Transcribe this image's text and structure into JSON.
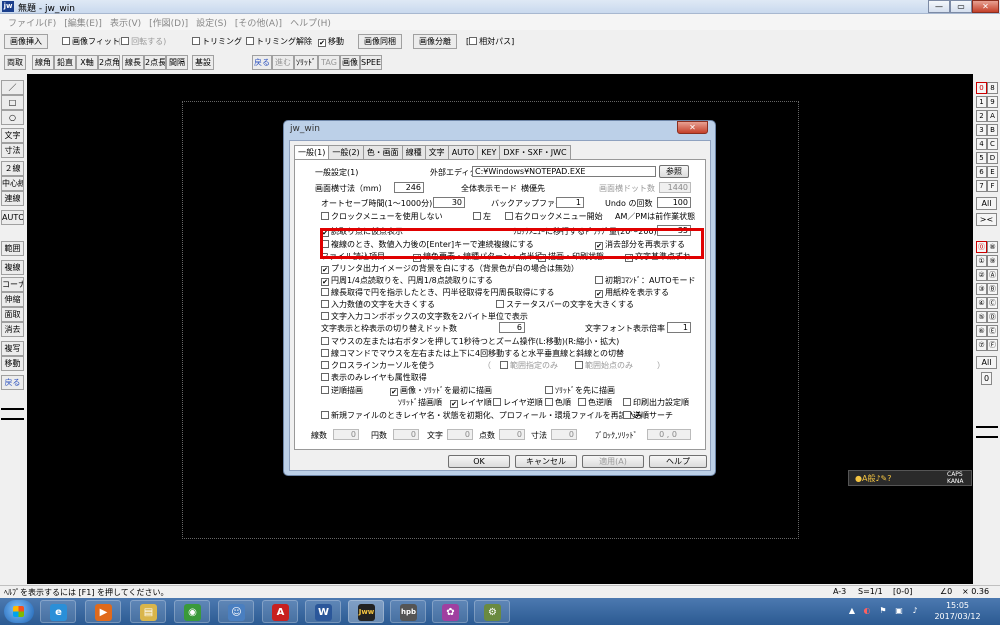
{
  "window": {
    "title": "無題 - jw_win",
    "logo": "jw",
    "minimize": "—",
    "maximize": "▭",
    "close": "✕"
  },
  "menu": [
    "ファイル(F)",
    "[編集(E)]",
    "表示(V)",
    "[作図(D)]",
    "設定(S)",
    "[その他(A)]",
    "ヘルプ(H)"
  ],
  "toolbar1": {
    "insert_image": "画像挿入",
    "fit_image": "画像フィット",
    "rotate_open": "(",
    "rotate": "回転する",
    "rotate_close": ")",
    "trimming": "トリミング",
    "trimming_cancel": "トリミング解除",
    "move": "移動",
    "image_same": "画像同梱",
    "image_split": "画像分離",
    "relpath_open": "[",
    "relpath": "相対パス",
    "relpath_close": "]"
  },
  "toolbar2": [
    "両取",
    "線角",
    "鉛直",
    "X軸",
    "2点角",
    "線長",
    "2点長",
    "間隔",
    "基設",
    "戻る",
    "進む",
    "ｿﾘｯﾄﾞ",
    "TAG",
    "画像",
    "SPEED"
  ],
  "left_tools": [
    "／",
    "□",
    "○",
    "文字",
    "寸法",
    "２線",
    "中心線",
    "連線",
    "AUTO",
    "範囲",
    "複線",
    "コーナー",
    "伸縮",
    "面取",
    "消去",
    "複写",
    "移動",
    "戻る"
  ],
  "right_pairs_top": [
    [
      "0",
      "8"
    ],
    [
      "1",
      "9"
    ],
    [
      "2",
      "A"
    ],
    [
      "3",
      "B"
    ],
    [
      "4",
      "C"
    ],
    [
      "5",
      "D"
    ],
    [
      "6",
      "E"
    ],
    [
      "7",
      "F"
    ]
  ],
  "right_pairs_bottom": [
    [
      "⓪",
      "⑧"
    ],
    [
      "①",
      "⑨"
    ],
    [
      "②",
      "Ⓐ"
    ],
    [
      "③",
      "Ⓑ"
    ],
    [
      "④",
      "Ⓒ"
    ],
    [
      "⑤",
      "Ⓓ"
    ],
    [
      "⑥",
      "Ⓔ"
    ],
    [
      "⑦",
      "Ⓕ"
    ]
  ],
  "right_all": "All",
  "right_arrow": "><",
  "right_zero": "0",
  "dialog": {
    "title": "jw_win",
    "close": "✕",
    "tabs": [
      "一般(1)",
      "一般(2)",
      "色・画面",
      "線種",
      "文字",
      "AUTO",
      "KEY",
      "DXF・SXF・JWC"
    ],
    "header": "一般設定(1)",
    "editor_label": "外部エディタ",
    "editor_value": "C:¥Windows¥NOTEPAD.EXE",
    "browse": "参照",
    "screen_size_label": "画面横寸法（mm）",
    "screen_size_value": "246",
    "full_mode": "全体表示モード",
    "priority": "横優先",
    "dots_label": "画面横ドット数",
    "dots_value": "1440",
    "autosave_label": "オートセーブ時間(1～1000分)",
    "autosave_value": "30",
    "backup_label": "バックアップファイル数",
    "backup_value": "1",
    "undo_label": "Undo の回数",
    "undo_value": "100",
    "clock_menu": "クロックメニューを使用しない",
    "left": "左",
    "right_start": "右クロックメニュー開始",
    "ampm": "AM／PMは前作業状態",
    "read_point": "読取り点に仮点表示",
    "clock_drag_label": "ｸﾛｯｸﾒﾆｭｰに移行するﾄﾞﾗｯｸﾞ量(20～200)",
    "clock_drag_value": "35",
    "multi_line": "複線のとき、数値入力後の[Enter]キーで連続複線にする",
    "redraw_erased": "消去部分を再表示する",
    "file_items_label": "ファイル読込項目",
    "line_color": "線色要素・線種パターン・点半径",
    "draw_print": "描画・印刷状態",
    "text_base": "文字基準点ずれ",
    "print_white": "プリンタ出力イメージの背景を白にする（背景色が白の場合は無効）",
    "circle_read": "円周1/4点読取りを、円周1/8点読取りにする",
    "init_auto": "初期ｺﾏﾝﾄﾞ：AUTOモード",
    "circle_radius": "線長取得で円を指示したとき、円半径取得を円周長取得にする",
    "paper_frame": "用紙枠を表示する",
    "input_large": "入力数値の文字を大きくする",
    "status_large": "ステータスバーの文字を大きくする",
    "combo_2byte": "文字入力コンボボックスの文字数を2バイト単位で表示",
    "switch_dots_label": "文字表示と枠表示の切り替えドット数",
    "switch_dots_value": "6",
    "font_scale_label": "文字フォント表示倍率",
    "font_scale_value": "1",
    "mouse_zoom": "マウスの左または右ボタンを押して1秒待つとズーム操作(L:移動)(R:縮小・拡大)",
    "line_command": "線コマンドでマウスを左右または上下に4回移動すると水平垂直線と斜線との切替",
    "crossline": "クロスラインカーソルを使う",
    "range_only": "範囲指定のみ",
    "range_point": "範囲始点のみ",
    "paren_open": "（",
    "paren_close": "）",
    "layer_only": "表示のみレイヤも属性取得",
    "reverse_draw": "逆順描画",
    "image_first": "画像・ｿﾘｯﾄﾞを最初に描画",
    "solid_first": "ｿﾘｯﾄﾞを先に描画",
    "solid_order_label": "ｿﾘｯﾄﾞ描画順",
    "layer_order": "レイヤ順",
    "layer_reverse": "レイヤ逆順",
    "color_order": "色順",
    "color_reverse": "色逆順",
    "print_order": "印刷出力設定順",
    "new_file_init": "新規ファイルのときレイヤ名・状態を初期化、プロフィール・環境ファイルを再読込み",
    "reverse_search": "逆順サーチ",
    "stats": [
      {
        "label": "線数",
        "value": "0"
      },
      {
        "label": "円数",
        "value": "0"
      },
      {
        "label": "文字",
        "value": "0"
      },
      {
        "label": "点数",
        "value": "0"
      },
      {
        "label": "寸法",
        "value": "0"
      },
      {
        "label": "ﾌﾞﾛｯｸ,ｿﾘｯﾄﾞ",
        "value": "0 , 0"
      }
    ],
    "ok": "OK",
    "cancel": "キャンセル",
    "apply": "適用(A)",
    "help": "ヘルプ"
  },
  "statusbar": {
    "help": "ﾍﾙﾌﾟを表示するには [F1] を押してください。",
    "paper": "A-3",
    "scale": "S=1/1",
    "layer": "[0-0]",
    "angle": "∠0",
    "zoom": "× 0.36"
  },
  "ime": {
    "icons": "●A般♪✎?",
    "caps": "CAPS",
    "kana": "KANA"
  },
  "taskbar": {
    "apps": [
      {
        "name": "ie",
        "glyph": "e",
        "color": "#2a8fd8"
      },
      {
        "name": "media",
        "glyph": "▶",
        "color": "#e06a1c"
      },
      {
        "name": "explorer",
        "glyph": "▤",
        "color": "#d9b54a"
      },
      {
        "name": "chrome",
        "glyph": "◉",
        "color": "#3a9a3a"
      },
      {
        "name": "messenger",
        "glyph": "☺",
        "color": "#4a7fc0"
      },
      {
        "name": "acrobat",
        "glyph": "A",
        "color": "#c82020"
      },
      {
        "name": "word",
        "glyph": "W",
        "color": "#2b579a"
      },
      {
        "name": "jww",
        "glyph": "Jww",
        "color": "#222222"
      },
      {
        "name": "hpb",
        "glyph": "hpb",
        "color": "#555555"
      },
      {
        "name": "paint",
        "glyph": "✿",
        "color": "#a040a0"
      },
      {
        "name": "misc",
        "glyph": "⚙",
        "color": "#6a8a40"
      }
    ],
    "tray": [
      "▲",
      "◐",
      "⚑",
      "▣",
      "♪"
    ],
    "time": "15:05",
    "date": "2017/03/12"
  }
}
